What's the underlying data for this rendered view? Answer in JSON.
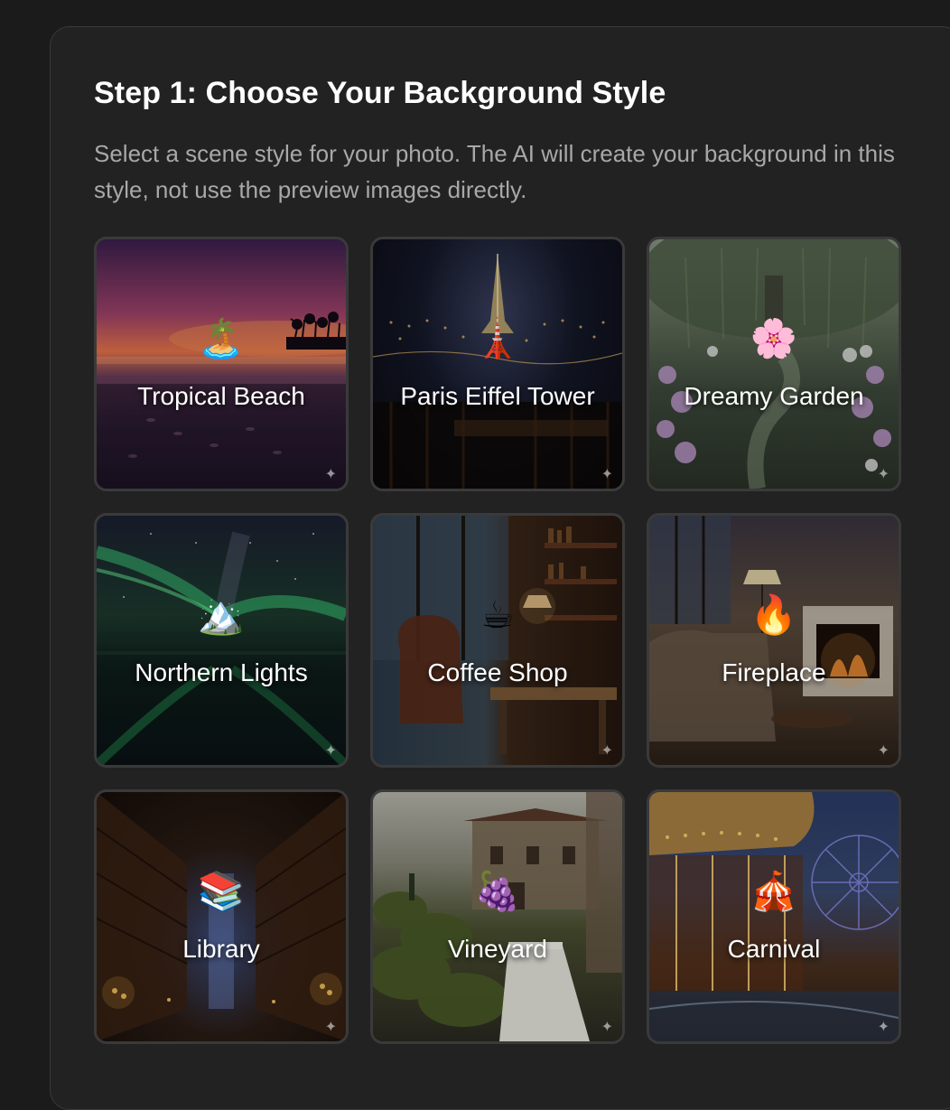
{
  "header": {
    "title": "Step 1: Choose Your Background Style",
    "description": "Select a scene style for your photo. The AI will create your background in this style, not use the preview images directly."
  },
  "styles": [
    {
      "label": "Tropical Beach",
      "emoji": "🏝️",
      "icon": "island-icon"
    },
    {
      "label": "Paris Eiffel Tower",
      "emoji": "🗼",
      "icon": "tower-icon"
    },
    {
      "label": "Dreamy Garden",
      "emoji": "🌸",
      "icon": "blossom-icon"
    },
    {
      "label": "Northern Lights",
      "emoji": "🏔️",
      "icon": "mountain-icon"
    },
    {
      "label": "Coffee Shop",
      "emoji": "☕",
      "icon": "coffee-icon"
    },
    {
      "label": "Fireplace",
      "emoji": "🔥",
      "icon": "fire-icon"
    },
    {
      "label": "Library",
      "emoji": "📚",
      "icon": "books-icon"
    },
    {
      "label": "Vineyard",
      "emoji": "🍇",
      "icon": "grapes-icon"
    },
    {
      "label": "Carnival",
      "emoji": "🎪",
      "icon": "circus-tent-icon"
    }
  ],
  "sparkle_glyph": "✦"
}
